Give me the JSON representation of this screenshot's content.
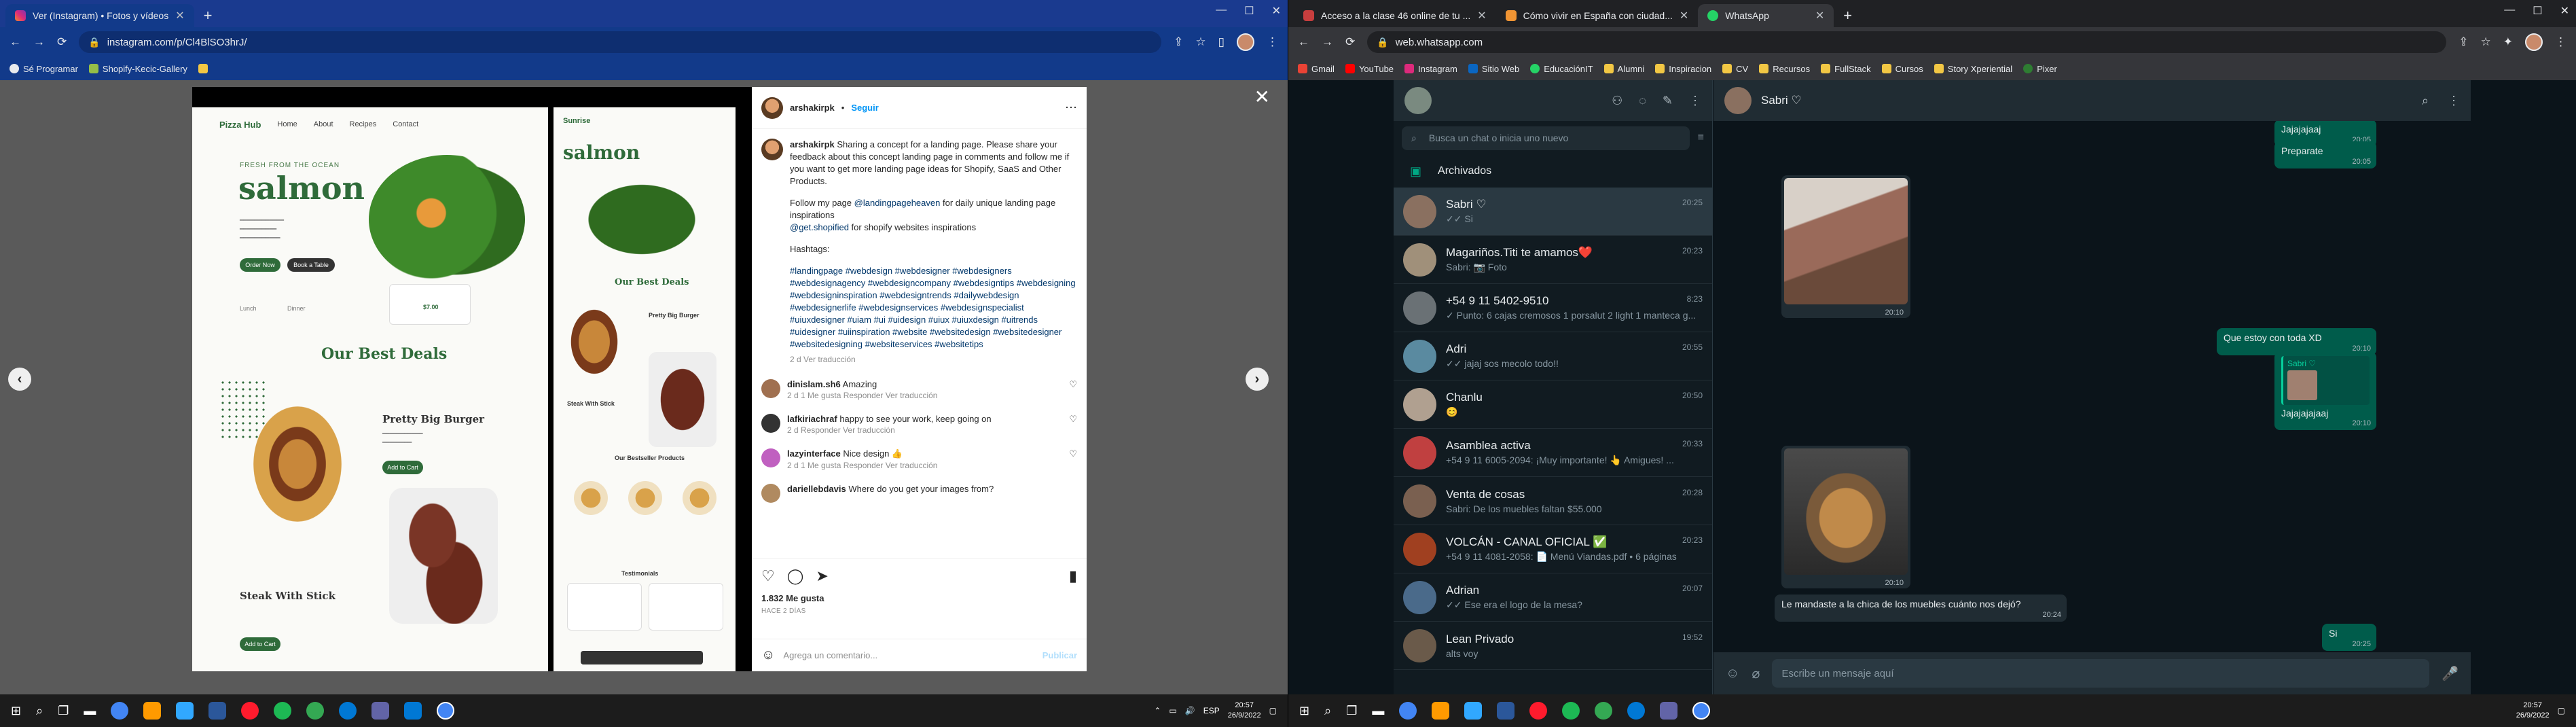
{
  "left": {
    "tab": {
      "title": "Ver (Instagram) • Fotos y vídeos"
    },
    "url": "instagram.com/p/Cl4BlSO3hrJ/",
    "bookmarks": [
      "Sé Programar",
      "Shopify-Kecic-Gallery"
    ],
    "mockup": {
      "logo_left": "Pizza Hub",
      "logo_right": "Sunrise",
      "nav": [
        "Home",
        "About",
        "Recipes",
        "Contact"
      ],
      "eyebrow": "FRESH FROM THE OCEAN",
      "hero_title": "salmon",
      "btn_order": "Order Now",
      "btn_menu": "Book a Table",
      "best_deals": "Our Best Deals",
      "deal_title": "Pretty Big Burger",
      "steak_title": "Steak With Stick",
      "btn_add": "Add to Cart",
      "price": "$7.00",
      "labels": [
        "Lunch",
        "Dinner"
      ],
      "right_sections": [
        "Our Best Deals",
        "Pretty Big Burger",
        "Steak With Stick",
        "Our Bestseller Products",
        "Testimonials"
      ]
    },
    "instagram": {
      "username": "arshakirpk",
      "follow": "Seguir",
      "caption_1": "Sharing a concept for a landing page. Please share your feedback about this concept landing page in comments and follow me if you want to get more landing page ideas for Shopify, SaaS and Other Products.",
      "caption_2_pre": "Follow my page ",
      "caption_2_link": "@landingpageheaven",
      "caption_2_post": " for daily unique landing page inspirations",
      "caption_3_link": "@get.shopified",
      "caption_3_post": " for shopify websites inspirations",
      "hashtags_label": "Hashtags:",
      "hashtags": "#landingpage #webdesign #webdesigner #webdesigners #webdesignagency #webdesigncompany #webdesigntips #webdesigning #webdesigninspiration #webdesigntrends #dailywebdesign #webdesignerlife #webdesignservices #webdesignspecialist #uiuxdesigner #uiam #ui #uidesign #uiux #uiuxdesign #uitrends #uidesigner #uiinspiration #website #websitedesign #websitedesigner #websitedesigning #websiteservices #websitetips",
      "caption_meta": "2 d   Ver traducción",
      "comments": [
        {
          "user": "dinislam.sh6",
          "text": "Amazing",
          "meta": "2 d   1 Me gusta   Responder   Ver traducción"
        },
        {
          "user": "lafkiriachraf",
          "text": "happy to see your work, keep going on",
          "meta": "2 d   Responder   Ver traducción"
        },
        {
          "user": "lazyinterface",
          "text": "Nice design 👍",
          "meta": "2 d   1 Me gusta   Responder   Ver traducción"
        },
        {
          "user": "dariellebdavis",
          "text": "Where do you get your images from?",
          "meta": ""
        }
      ],
      "likes": "1.832 Me gusta",
      "date": "HACE 2 DÍAS",
      "comment_placeholder": "Agrega un comentario...",
      "publish": "Publicar"
    },
    "clock": {
      "time": "20:57",
      "date": "26/9/2022",
      "lang": "ESP"
    }
  },
  "right": {
    "tabs": [
      {
        "title": "Acceso a la clase 46 online de tu ..."
      },
      {
        "title": "Cómo vivir en España con ciudad..."
      },
      {
        "title": "WhatsApp"
      }
    ],
    "url": "web.whatsapp.com",
    "bookmarks": [
      "Gmail",
      "YouTube",
      "Instagram",
      "Sitio Web",
      "EducaciónIT",
      "Alumni",
      "Inspiracion",
      "CV",
      "Recursos",
      "FullStack",
      "Cursos",
      "Story Xperiential",
      "Pixer"
    ],
    "whatsapp": {
      "search_placeholder": "Busca un chat o inicia uno nuevo",
      "archived": "Archivados",
      "active_contact": "Sabri ♡",
      "chats": [
        {
          "name": "Sabri ♡",
          "time": "20:25",
          "preview": "✓✓ Si",
          "color": "#8a7060"
        },
        {
          "name": "Magariños.Titi te amamos❤️",
          "time": "20:23",
          "preview": "Sabri: 📷 Foto",
          "color": "#a0907a"
        },
        {
          "name": "+54 9 11 5402-9510",
          "time": "8:23",
          "preview": "✓ Punto: 6 cajas cremosos 1 porsalut 2 light 1 manteca g...",
          "color": "#6a7175"
        },
        {
          "name": "Adri",
          "time": "20:55",
          "preview": "✓✓ jajaj sos mecolo todo!!",
          "color": "#5a8aa0"
        },
        {
          "name": "Chanlu",
          "time": "20:50",
          "preview": "😊",
          "color": "#b0a090"
        },
        {
          "name": "Asamblea activa",
          "time": "20:33",
          "preview": "+54 9 11 6005-2094: ¡Muy importante! 👆 Amigues! ...",
          "color": "#c04040"
        },
        {
          "name": "Venta de cosas",
          "time": "20:28",
          "preview": "Sabri: De los muebles faltan $55.000",
          "color": "#7a6050"
        },
        {
          "name": "VOLCÁN - CANAL OFICIAL ✅",
          "time": "20:23",
          "preview": "+54 9 11 4081-2058: 📄 Menú Viandas.pdf • 6 páginas",
          "color": "#a04020"
        },
        {
          "name": "Adrian",
          "time": "20:07",
          "preview": "✓✓ Ese era el logo de la mesa?",
          "color": "#4a6a8a"
        },
        {
          "name": "Lean Privado",
          "time": "19:52",
          "preview": "alts voy",
          "color": "#6a5a4a"
        }
      ],
      "messages": {
        "top_out_1": {
          "text": "Jajajajaaj",
          "time": "20:05"
        },
        "top_out_2": {
          "text": "Preparate",
          "time": "20:05"
        },
        "photo_1_time": "20:10",
        "out_que_estoy": {
          "text": "Que estoy con toda XD",
          "time": "20:10"
        },
        "quote_name": "Sabri ♡",
        "quote_text": "Jajajajajaaj",
        "quote_time": "20:10",
        "photo_2_time": "20:10",
        "in_muebles": {
          "text": "Le mandaste a la chica de los muebles cuánto nos dejó?",
          "time": "20:24"
        },
        "out_si": {
          "text": "Si",
          "time": "20:25"
        }
      },
      "input_placeholder": "Escribe un mensaje aquí"
    },
    "clock": {
      "time": "20:57",
      "date": "26/9/2022"
    }
  },
  "colors": {
    "ig_blue": "#0095f6",
    "wa_green": "#00a884",
    "wa_bubble_out": "#005c4b",
    "wa_bubble_in": "#202c33"
  }
}
